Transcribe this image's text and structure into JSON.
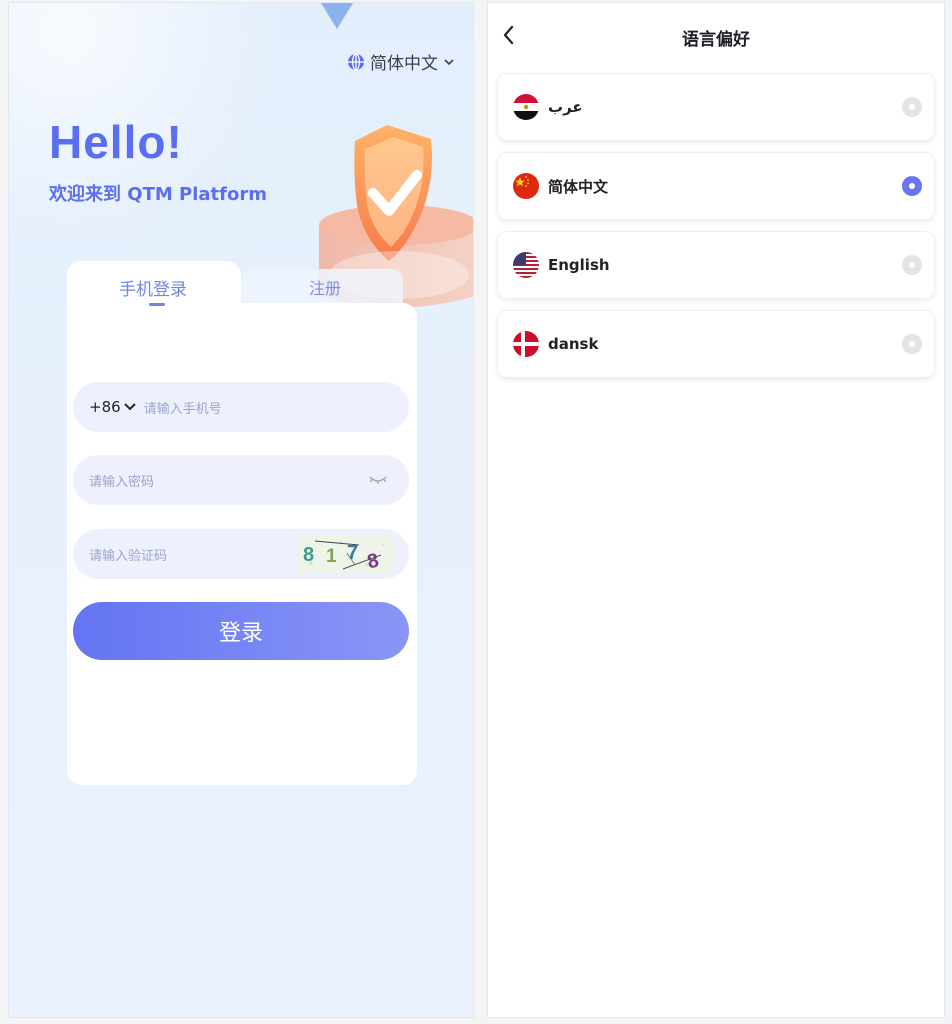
{
  "login_screen": {
    "language_selector": {
      "label": "简体中文",
      "icon": "globe-icon"
    },
    "greeting": "Hello!",
    "welcome": "欢迎来到 QTM Platform",
    "tabs": [
      {
        "label": "手机登录",
        "active": true
      },
      {
        "label": "注册",
        "active": false
      }
    ],
    "phone": {
      "country_code": "+86",
      "placeholder": "请输入手机号"
    },
    "password": {
      "placeholder": "请输入密码"
    },
    "captcha": {
      "placeholder": "请输入验证码",
      "code": "8178"
    },
    "login_button": "登录",
    "colors": {
      "accent": "#6474f3",
      "accent_light": "#8a96f6",
      "field_bg": "#eef0fd",
      "bg": "#e6effc"
    }
  },
  "language_screen": {
    "title": "语言偏好",
    "languages": [
      {
        "label": "عرب",
        "flag": "egypt-flag",
        "selected": false
      },
      {
        "label": "简体中文",
        "flag": "china-flag",
        "selected": true
      },
      {
        "label": "English",
        "flag": "usa-flag",
        "selected": false
      },
      {
        "label": "dansk",
        "flag": "denmark-flag",
        "selected": false
      }
    ],
    "colors": {
      "radio_on": "#6876ee",
      "radio_off": "#e4e4e6"
    }
  }
}
